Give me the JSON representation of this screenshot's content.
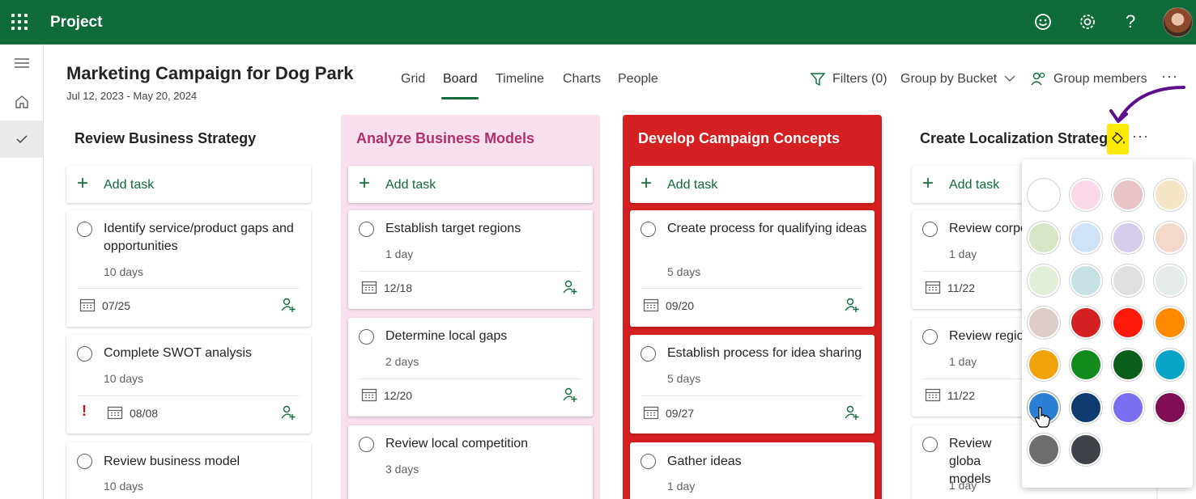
{
  "app": {
    "title": "Project"
  },
  "header": {
    "plan_title": "Marketing Campaign for Dog Park",
    "dates": "Jul 12, 2023 - May 20, 2024",
    "tabs": [
      {
        "label": "Grid"
      },
      {
        "label": "Board"
      },
      {
        "label": "Timeline"
      },
      {
        "label": "Charts"
      },
      {
        "label": "People"
      }
    ],
    "active_tab": "Board",
    "filters_label": "Filters (0)",
    "group_by_label": "Group by Bucket",
    "group_members_label": "Group members"
  },
  "add_task_label": "Add task",
  "buckets": [
    {
      "title": "Review Business Strategy",
      "title_color": "#242424",
      "tasks": [
        {
          "name": "Identify service/product gaps and opportunities",
          "duration": "10 days",
          "date": "07/25"
        },
        {
          "name": "Complete SWOT analysis",
          "duration": "10 days",
          "date": "08/08",
          "urgent": "!"
        },
        {
          "name": "Review business model",
          "duration": "10 days"
        }
      ]
    },
    {
      "title": "Analyze Business Models",
      "title_color": "#b0306f",
      "background": "#f9e0ee",
      "tasks": [
        {
          "name": "Establish target regions",
          "duration": "1 day",
          "date": "12/18"
        },
        {
          "name": "Determine local gaps",
          "duration": "2 days",
          "date": "12/20"
        },
        {
          "name": "Review local competition",
          "duration": "3 days"
        }
      ]
    },
    {
      "title": "Develop Campaign Concepts",
      "title_color": "#ffffff",
      "background": "#d42020",
      "tasks": [
        {
          "name": "Create process for qualifying ideas",
          "duration": "5 days",
          "date": "09/20"
        },
        {
          "name": "Establish process for idea sharing",
          "duration": "5 days",
          "date": "09/27"
        },
        {
          "name": "Gather ideas",
          "duration": "1 day"
        }
      ]
    },
    {
      "title": "Create Localization Strateg",
      "title_color": "#242424",
      "tasks": [
        {
          "name": "Review corpo",
          "duration": "1 day",
          "date": "11/22"
        },
        {
          "name": "Review regio",
          "duration": "1 day",
          "date": "11/22"
        },
        {
          "name": "Review globa models",
          "duration": "1 day"
        }
      ]
    }
  ],
  "color_picker": {
    "swatches": [
      "#ffffff",
      "#f9d9ea",
      "#e9c4c7",
      "#f5e6c5",
      "#d6e6c7",
      "#cfe2f8",
      "#d7cdea",
      "#f2d9cc",
      "#e2efd9",
      "#c7e2e4",
      "#e0e0e0",
      "#e6ecec",
      "#dccdc8",
      "#d42020",
      "#ff1a0a",
      "#ff8a00",
      "#f0a30a",
      "#128b1c",
      "#0b5e1a",
      "#0aa4c7",
      "#2b7fd4",
      "#0e3b70",
      "#7a6ff0",
      "#800e52",
      "#6d6d6d",
      "#3d4349"
    ],
    "selected_index": 20
  },
  "colors": {
    "brand": "#0f6b3a",
    "annotation_arrow": "#5b0f8e",
    "highlight": "#ffea00"
  }
}
